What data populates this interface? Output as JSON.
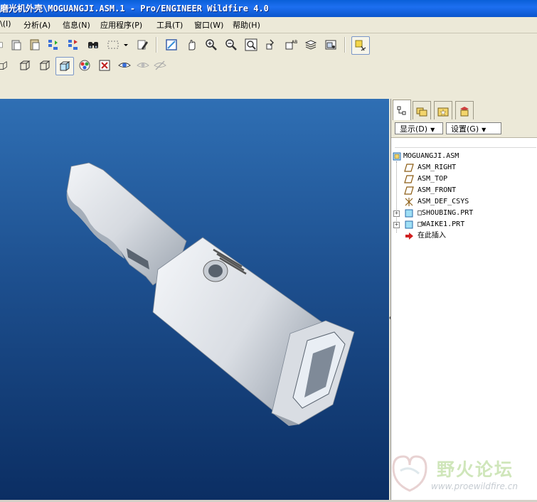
{
  "window": {
    "title": "磨光机外壳\\MOGUANGJI.ASM.1 - Pro/ENGINEER Wildfire 4.0"
  },
  "menu": {
    "items": [
      {
        "label": "\\(I)"
      },
      {
        "label": "分析(A)"
      },
      {
        "label": "信息(N)"
      },
      {
        "label": "应用程序(P)"
      },
      {
        "label": "工具(T)"
      },
      {
        "label": "窗口(W)"
      },
      {
        "label": "帮助(H)"
      }
    ]
  },
  "toolbar1_icons": [
    "copy-icon",
    "paste-icon",
    "regenerate-icon",
    "regen-manager-icon",
    "find-icon",
    "select-box-icon",
    "select-dropdown-icon",
    "edit-icon",
    "repaint-icon",
    "spin-icon",
    "zoom-in-icon",
    "zoom-out-icon",
    "refit-icon",
    "reorient-icon",
    "saved-views-icon",
    "layers-icon",
    "view-manager-icon",
    "datum-display-icon"
  ],
  "toolbar2_icons": [
    "wireframe-icon",
    "hidden-line-icon",
    "no-hidden-icon",
    "shading-icon",
    "appearance-icon",
    "model-tree-close-icon",
    "visibility-icon",
    "eye-disabled-icon",
    "hide-icon"
  ],
  "panel": {
    "tabs": [
      "model-tree-tab",
      "folder-browser-tab",
      "favorites-tab",
      "connections-tab"
    ],
    "show_button": "显示(D)",
    "settings_button": "设置(G)",
    "tree": [
      {
        "label": "MOGUANGJI.ASM",
        "icon": "assembly-icon",
        "level": 0,
        "expandable": false
      },
      {
        "label": "ASM_RIGHT",
        "icon": "datum-plane-icon",
        "level": 1,
        "expandable": false
      },
      {
        "label": "ASM_TOP",
        "icon": "datum-plane-icon",
        "level": 1,
        "expandable": false
      },
      {
        "label": "ASM_FRONT",
        "icon": "datum-plane-icon",
        "level": 1,
        "expandable": false
      },
      {
        "label": "ASM_DEF_CSYS",
        "icon": "csys-icon",
        "level": 1,
        "expandable": false
      },
      {
        "label": "□SHOUBING.PRT",
        "icon": "part-icon",
        "level": 1,
        "expandable": true
      },
      {
        "label": "□WAIKE1.PRT",
        "icon": "part-icon",
        "level": 1,
        "expandable": true
      },
      {
        "label": "在此插入",
        "icon": "insert-here-icon",
        "level": 1,
        "expandable": false
      }
    ]
  },
  "watermark": {
    "text": "野火论坛",
    "url": "www.proewildfire.cn"
  },
  "colors": {
    "titlebar": "#0a5fd8",
    "viewport_top": "#2f6fb4",
    "viewport_bottom": "#0b2e63",
    "model": "#d9dde3"
  }
}
